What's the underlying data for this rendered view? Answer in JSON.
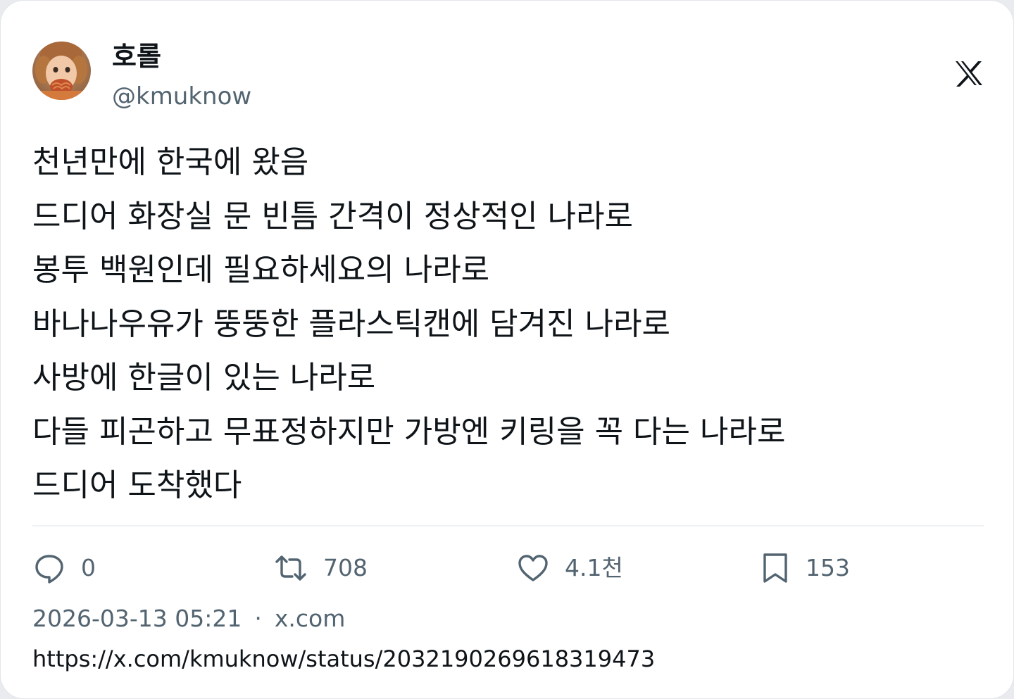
{
  "author": {
    "display_name": "호롤",
    "handle": "@kmuknow"
  },
  "brand": {
    "logo": "x-logo",
    "color": "#0f1419"
  },
  "tweet": {
    "lines": [
      "천년만에 한국에 왔음",
      "드디어 화장실 문 빈틈 간격이 정상적인 나라로",
      "봉투 백원인데 필요하세요의 나라로",
      "바나나우유가 뚱뚱한 플라스틱캔에 담겨진 나라로",
      "사방에 한글이 있는 나라로",
      "다들 피곤하고 무표정하지만 가방엔 키링을 꼭 다는 나라로",
      "드디어 도착했다"
    ]
  },
  "actions": {
    "reply": {
      "icon": "reply-icon",
      "count": "0"
    },
    "retweet": {
      "icon": "retweet-icon",
      "count": "708"
    },
    "like": {
      "icon": "heart-icon",
      "count": "4.1천"
    },
    "bookmark": {
      "icon": "bookmark-icon",
      "count": "153"
    }
  },
  "meta": {
    "timestamp": "2026-03-13 05:21",
    "separator": "·",
    "source": "x.com",
    "url": "https://x.com/kmuknow/status/2032190269618319473"
  },
  "colors": {
    "text": "#0f1419",
    "secondary": "#536471",
    "divider": "#eff3f4",
    "background": "#ffffff"
  }
}
